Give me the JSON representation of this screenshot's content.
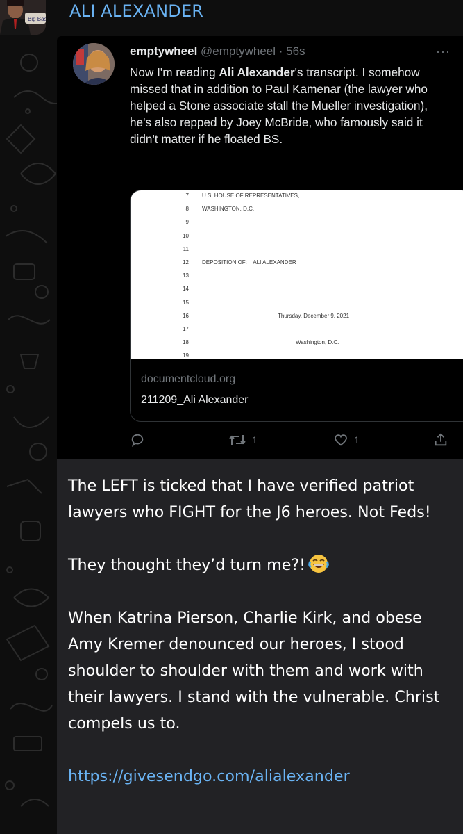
{
  "channel": {
    "name": "ALI ALEXANDER",
    "avatar_label": "Big Bash"
  },
  "tweet": {
    "display_name": "emptywheel",
    "handle": "@emptywheel",
    "time": "56s",
    "more_label": "···",
    "text_parts": [
      "Now I'm reading ",
      "Ali Alexander",
      "'s transcript. I somehow missed that in addition to Paul Kamenar (the lawyer who helped a Stone associate stall the Mueller investigation), he's also repped by Joey McBride, who famously said it didn't matter if he floated BS."
    ],
    "card": {
      "domain": "documentcloud.org",
      "title": "211209_Ali Alexander",
      "doc_lines": [
        {
          "num": "7",
          "text": "U.S. HOUSE OF REPRESENTATIVES,"
        },
        {
          "num": "8",
          "text": "WASHINGTON, D.C."
        },
        {
          "num": "9",
          "text": ""
        },
        {
          "num": "10",
          "text": ""
        },
        {
          "num": "11",
          "text": ""
        },
        {
          "num": "12",
          "text": "DEPOSITION OF:    ALI ALEXANDER"
        },
        {
          "num": "13",
          "text": ""
        },
        {
          "num": "14",
          "text": ""
        },
        {
          "num": "15",
          "text": ""
        },
        {
          "num": "16",
          "text": "Thursday, December 9, 2021"
        },
        {
          "num": "17",
          "text": ""
        },
        {
          "num": "18",
          "text": "Washington, D.C."
        },
        {
          "num": "19",
          "text": ""
        }
      ]
    },
    "actions": {
      "reply_count": "",
      "retweet_count": "1",
      "like_count": "1"
    }
  },
  "message": {
    "paragraph1": "The LEFT is ticked that I have verified patriot lawyers who FIGHT for the J6 heroes. Not Feds!",
    "paragraph2": "They thought they’d turn me?!",
    "paragraph2_emoji": "face-with-tears-of-joy",
    "paragraph3": "When Katrina Pierson, Charlie Kirk, and obese Amy Kremer denounced our heroes, I stood shoulder to shoulder with them and work with their lawyers. I stand with the vulnerable. Christ compels us to.",
    "link": "https://givesendgo.com/alialexander"
  },
  "colors": {
    "link": "#6ab3f3",
    "bubble": "#222225",
    "tweet_bg": "#000000",
    "muted": "#71767b"
  }
}
